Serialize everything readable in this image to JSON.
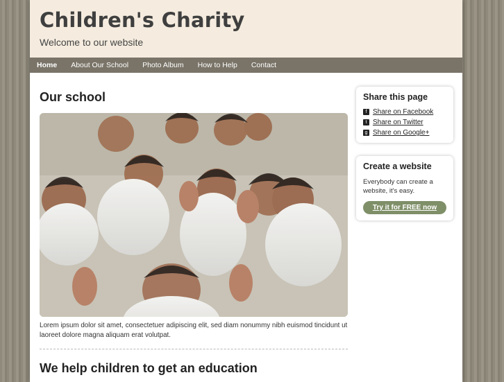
{
  "header": {
    "title": "Children's Charity",
    "subtitle": "Welcome to our website"
  },
  "nav": {
    "items": [
      "Home",
      "About Our School",
      "Photo Album",
      "How to Help",
      "Contact"
    ],
    "active": "Home"
  },
  "main": {
    "heading": "Our school",
    "photo_alt": "",
    "caption": "Lorem ipsum dolor sit amet, consectetuer adipiscing elit, sed diam nonummy nibh euismod tincidunt ut laoreet dolore magna aliquam erat volutpat.",
    "section_heading": "We help children to get an education"
  },
  "sidebar": {
    "share": {
      "title": "Share this page",
      "links": [
        {
          "label": "Share on Facebook",
          "icon": "facebook-icon"
        },
        {
          "label": "Share on Twitter",
          "icon": "twitter-icon"
        },
        {
          "label": "Share on Google+",
          "icon": "google-plus-icon"
        }
      ]
    },
    "create": {
      "title": "Create a website",
      "text": "Everybody can create a website, it's easy.",
      "button": "Try it for FREE now"
    }
  },
  "colors": {
    "header_bg": "#f5ecdf",
    "nav_bg": "#7a7468",
    "cta_bg": "#7f8f68"
  }
}
